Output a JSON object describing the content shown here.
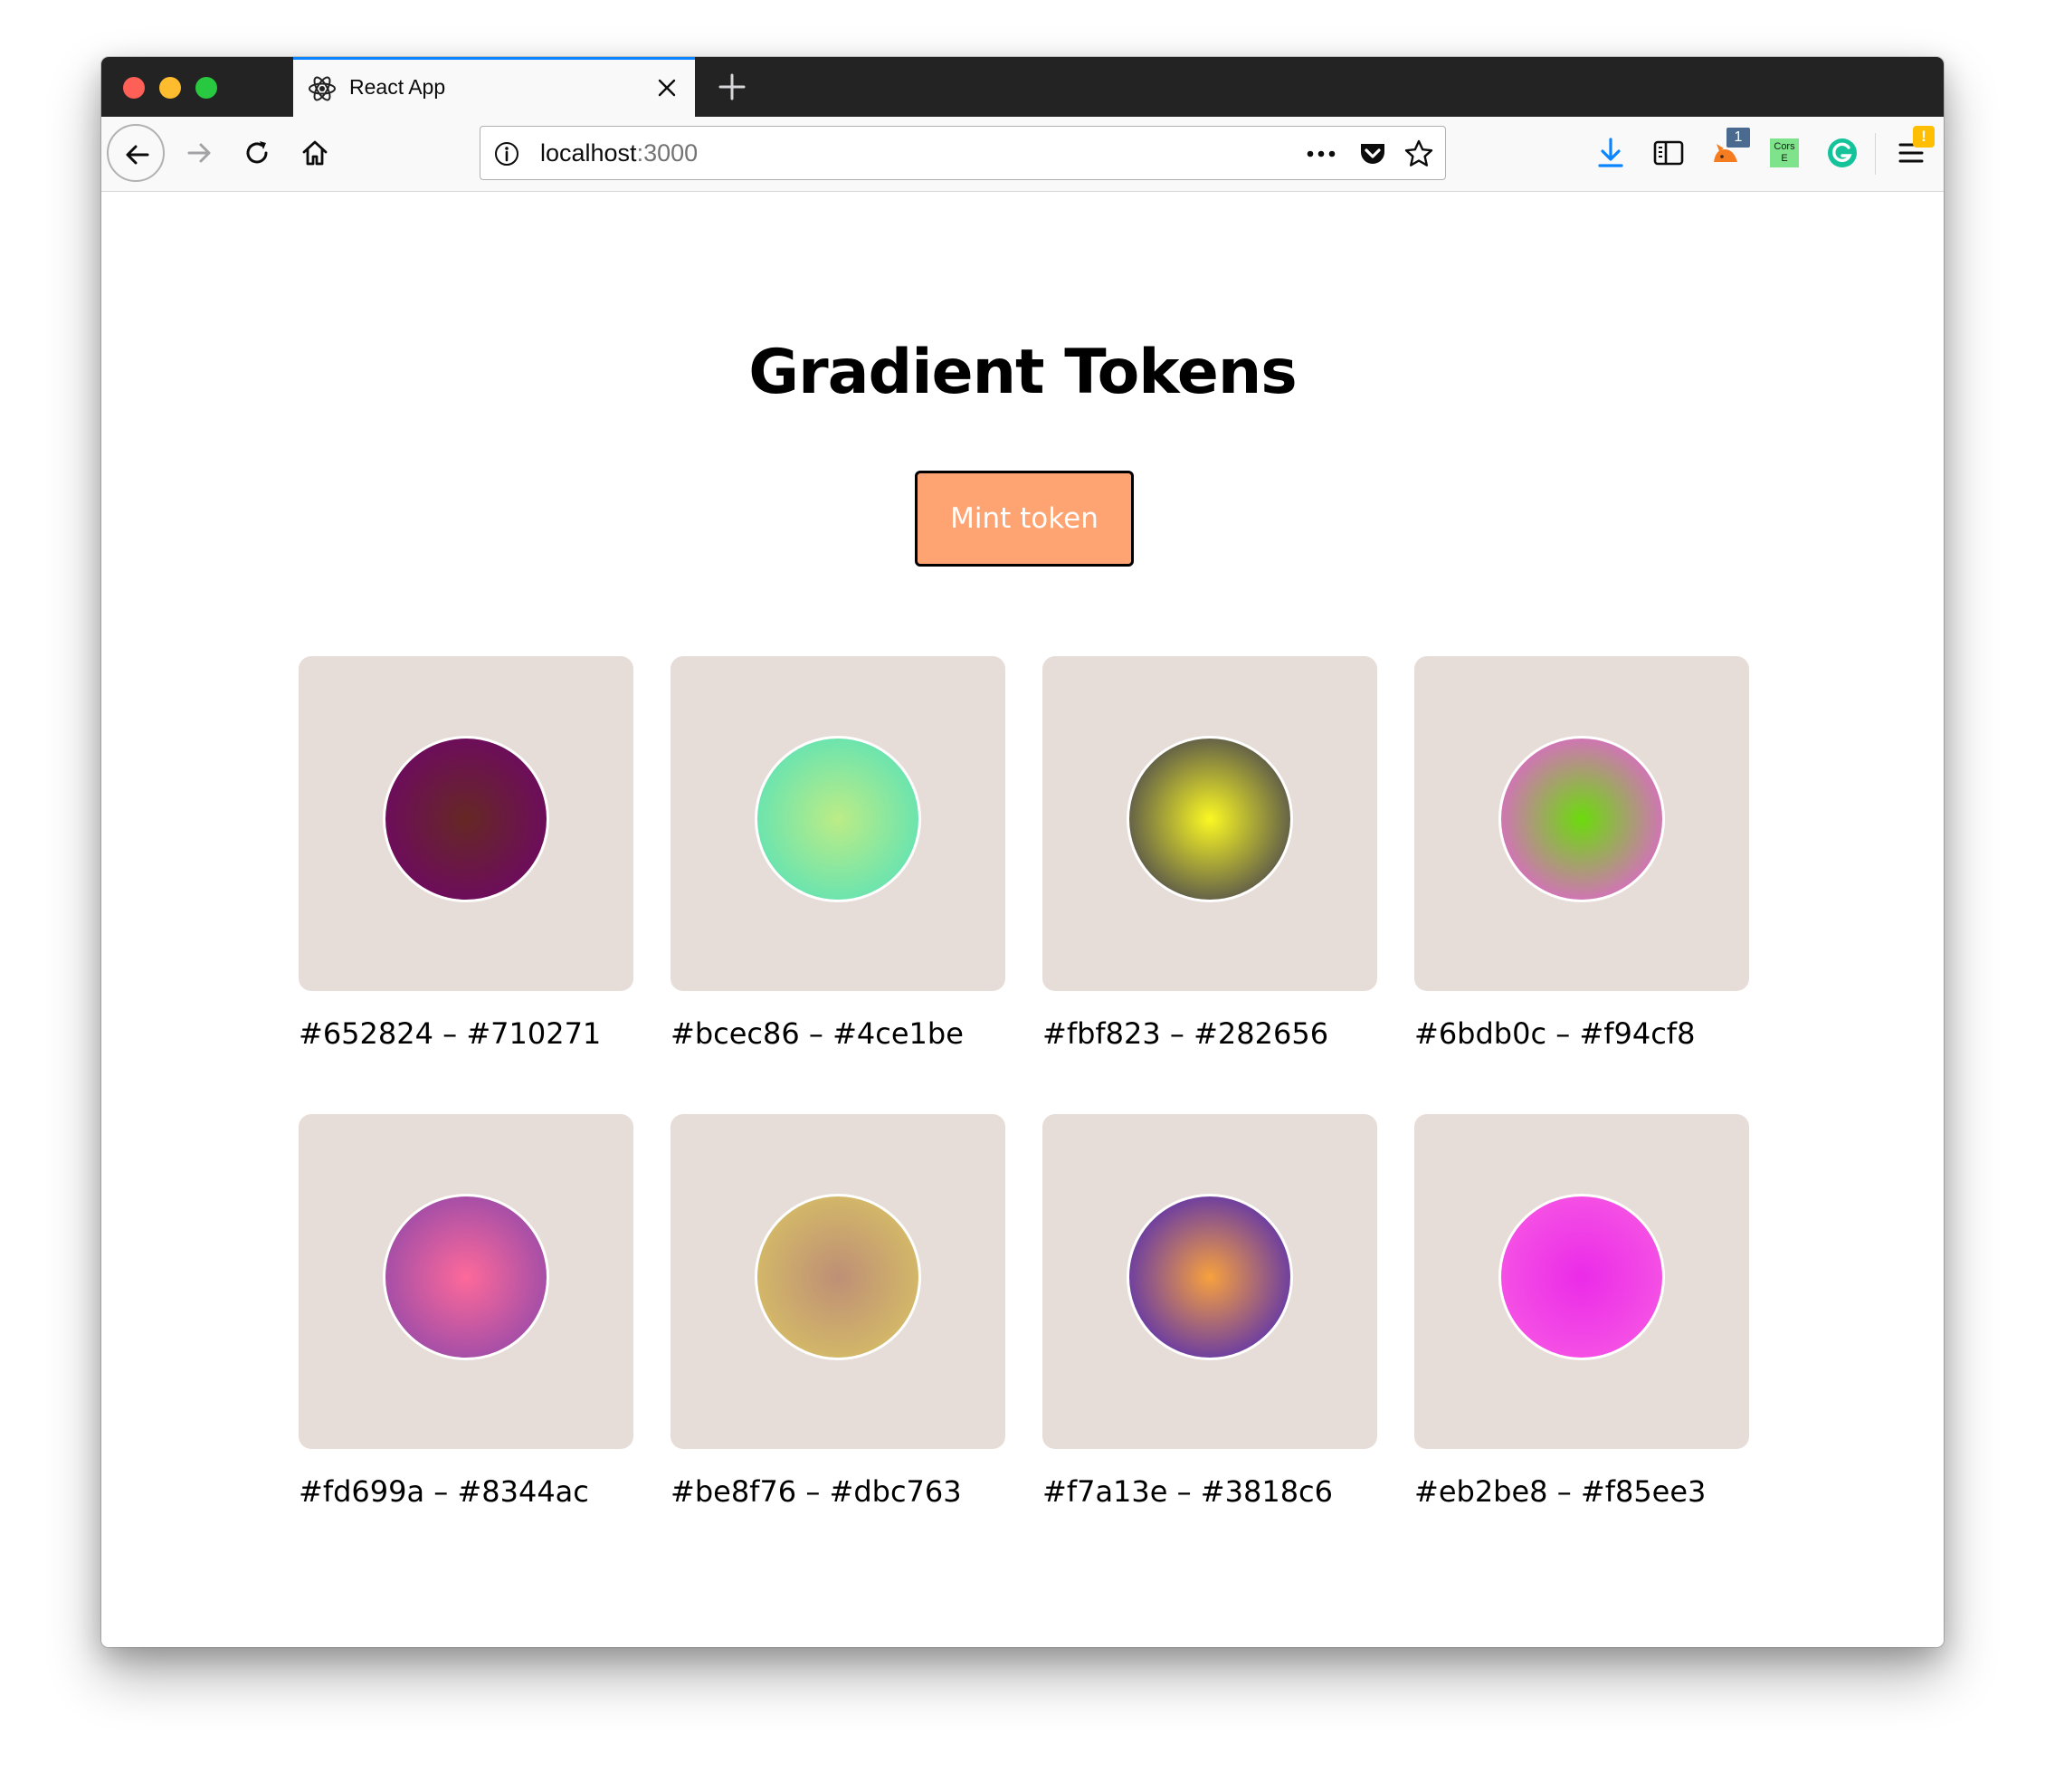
{
  "browser": {
    "tab_title": "React App",
    "url_host": "localhost",
    "url_port": ":3000"
  },
  "toolbar": {
    "ext_badge": "1",
    "cors_label_line1": "Cors",
    "cors_label_line2": "E",
    "menu_warning": "!"
  },
  "page": {
    "title": "Gradient Tokens",
    "mint_button": "Mint token",
    "tokens": [
      {
        "label": "#652824 – #710271",
        "inner": "#652824",
        "outer": "#710271"
      },
      {
        "label": "#bcec86 – #4ce1be",
        "inner": "#bcec86",
        "outer": "#4ce1be"
      },
      {
        "label": "#fbf823 – #282656",
        "inner": "#fbf823",
        "outer": "#282656"
      },
      {
        "label": "#6bdb0c – #f94cf8",
        "inner": "#6bdb0c",
        "outer": "#f94cf8"
      },
      {
        "label": "#fd699a – #8344ac",
        "inner": "#fd699a",
        "outer": "#8344ac"
      },
      {
        "label": "#be8f76 – #dbc763",
        "inner": "#be8f76",
        "outer": "#dbc763"
      },
      {
        "label": "#f7a13e – #3818c6",
        "inner": "#f7a13e",
        "outer": "#3818c6"
      },
      {
        "label": "#eb2be8 – #f85ee3",
        "inner": "#eb2be8",
        "outer": "#f85ee3"
      }
    ]
  },
  "colors": {
    "tile_background": "#e7ddd8",
    "mint_button_fill": "#fda472",
    "tab_accent": "#0a84ff"
  }
}
